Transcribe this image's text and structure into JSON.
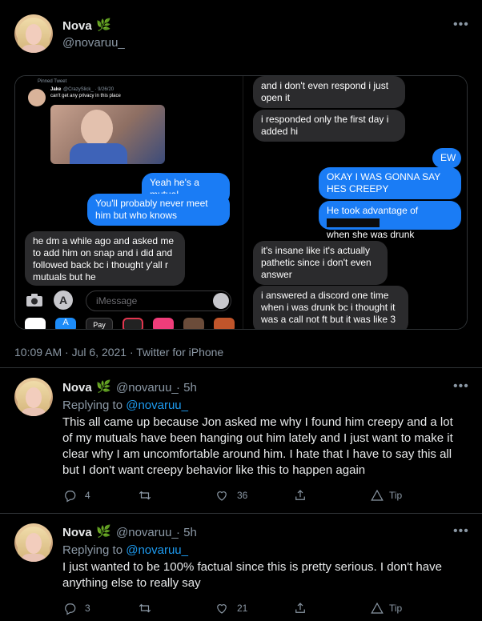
{
  "main_tweet": {
    "name": "Nova",
    "handle": "@novaruu_",
    "timestamp": "10:09 AM · Jul 6, 2021 · Twitter for iPhone"
  },
  "screenshot_left": {
    "pinned_label": "Pinned Tweet",
    "embedded_name": "Jake",
    "embedded_handle": "@CrazySlick_ · 9/26/20",
    "embedded_text": "can't get any privacy in this place",
    "messages": [
      {
        "text": "Yeah he's a mutual",
        "side": "right"
      },
      {
        "text": "You'll probably never meet him but who knows",
        "side": "right"
      },
      {
        "text": "he dm a while ago and asked me to add him on snap and i did and followed back bc i thought y'all r mutuals but he",
        "side": "left"
      }
    ],
    "input_placeholder": "iMessage",
    "applepay_label": "Pay"
  },
  "screenshot_right": {
    "messages": [
      {
        "text": "and i don't even respond i just open it",
        "side": "left"
      },
      {
        "text": "i responded only the first day i added hi",
        "side": "left"
      },
      {
        "text": "EW",
        "side": "right"
      },
      {
        "text": "OKAY I WAS GONNA SAY HES CREEPY",
        "side": "right"
      },
      {
        "text": "He took advantage of",
        "side": "right"
      },
      {
        "text": "when she was drunk",
        "side": "right"
      },
      {
        "text": "it's insane like it's actually pathetic since i don't even answer",
        "side": "left"
      },
      {
        "text": "i answered a discord one time when i was drunk bc i thought it was a call not ft but it was like 3",
        "side": "left"
      }
    ]
  },
  "reply1": {
    "name": "Nova",
    "handle": "@novaruu_",
    "time": "· 5h",
    "replying_prefix": "Replying to",
    "replying_handle": "@novaruu_",
    "text": "This all came up because Jon asked me why I found him creepy and a lot of my mutuals have been hanging out him lately and I just want to make it clear why I am uncomfortable around him. I hate that I have to say this all but I don't want creepy behavior like this to happen again",
    "replies": "4",
    "retweets": "",
    "likes": "36",
    "tip": "Tip"
  },
  "reply2": {
    "name": "Nova",
    "handle": "@novaruu_",
    "time": "· 5h",
    "replying_prefix": "Replying to",
    "replying_handle": "@novaruu_",
    "text": "I just wanted to be 100% factual since this is pretty serious. I don't have anything else to really say",
    "replies": "3",
    "retweets": "",
    "likes": "21",
    "tip": "Tip"
  },
  "icons": {
    "more": "more-icon",
    "leaf": "herb-icon",
    "reply": "reply-icon",
    "retweet": "retweet-icon",
    "like": "like-icon",
    "share": "share-icon",
    "tip": "tip-icon"
  },
  "colors": {
    "background": "#000000",
    "text": "#e7e9ea",
    "secondary": "#8b98a5",
    "link": "#1d9bf0",
    "imessage_blue": "#1a7cf5",
    "imessage_gray": "#2b2b2d"
  }
}
